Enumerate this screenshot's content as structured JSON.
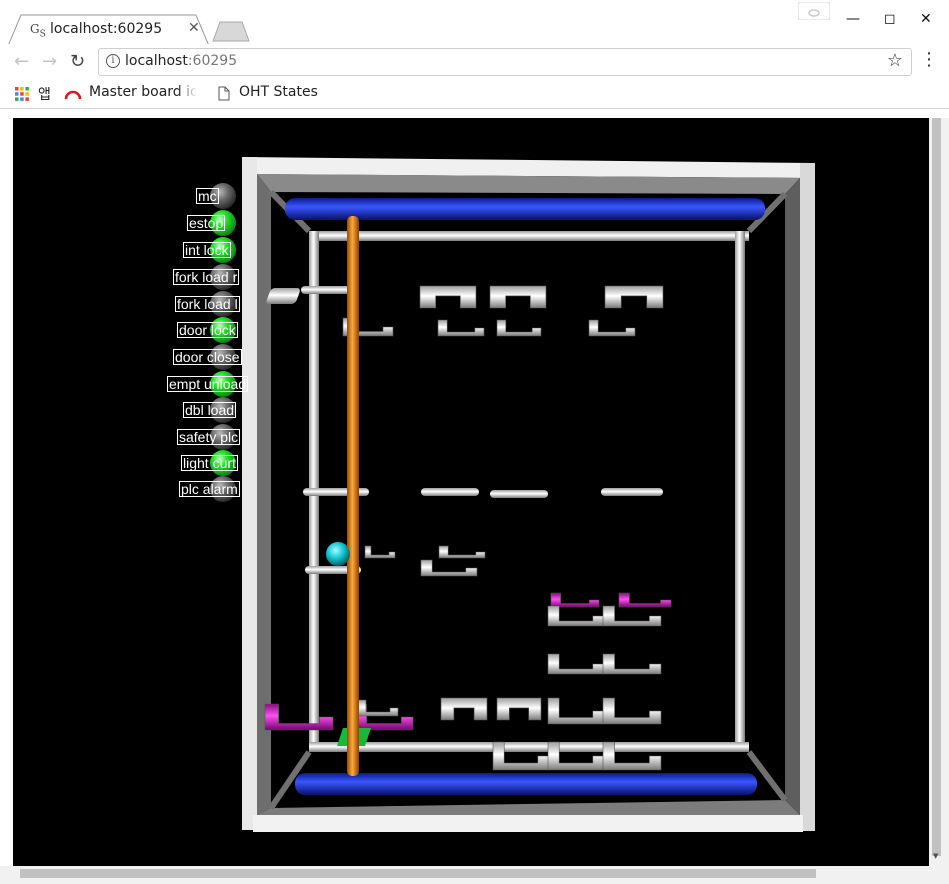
{
  "browser": {
    "tab_title": "localhost:60295",
    "favicon_text": "G",
    "favicon_sub": "S",
    "url_host": "localhost",
    "url_port": ":60295",
    "bookmarks": [
      {
        "label": "앱"
      },
      {
        "label": "Master board io"
      },
      {
        "label": "OHT States"
      }
    ]
  },
  "status_panel": {
    "items": [
      {
        "label": "mc",
        "state": "off"
      },
      {
        "label": "estop",
        "state": "on"
      },
      {
        "label": "int lock",
        "state": "on"
      },
      {
        "label": "fork load r",
        "state": "off"
      },
      {
        "label": "fork load l",
        "state": "off"
      },
      {
        "label": "door lock",
        "state": "on"
      },
      {
        "label": "door close",
        "state": "off"
      },
      {
        "label": "empt unload",
        "state": "on"
      },
      {
        "label": "dbl load",
        "state": "off"
      },
      {
        "label": "safety plc",
        "state": "off"
      },
      {
        "label": "light curt",
        "state": "on"
      },
      {
        "label": "plc alarm",
        "state": "off"
      }
    ]
  },
  "colors": {
    "page_background": "#000000",
    "frame": "#e6e6e6",
    "rail": "#1a35ff",
    "mast": "#e07a10",
    "cursor_ball": "#14c8d4",
    "occupied_slot": "#e020d0",
    "empty_slot": "#dcdcdc",
    "platform": "#17b93a",
    "lamp_on": "#22e42a",
    "lamp_off": "#6a6a6a"
  }
}
